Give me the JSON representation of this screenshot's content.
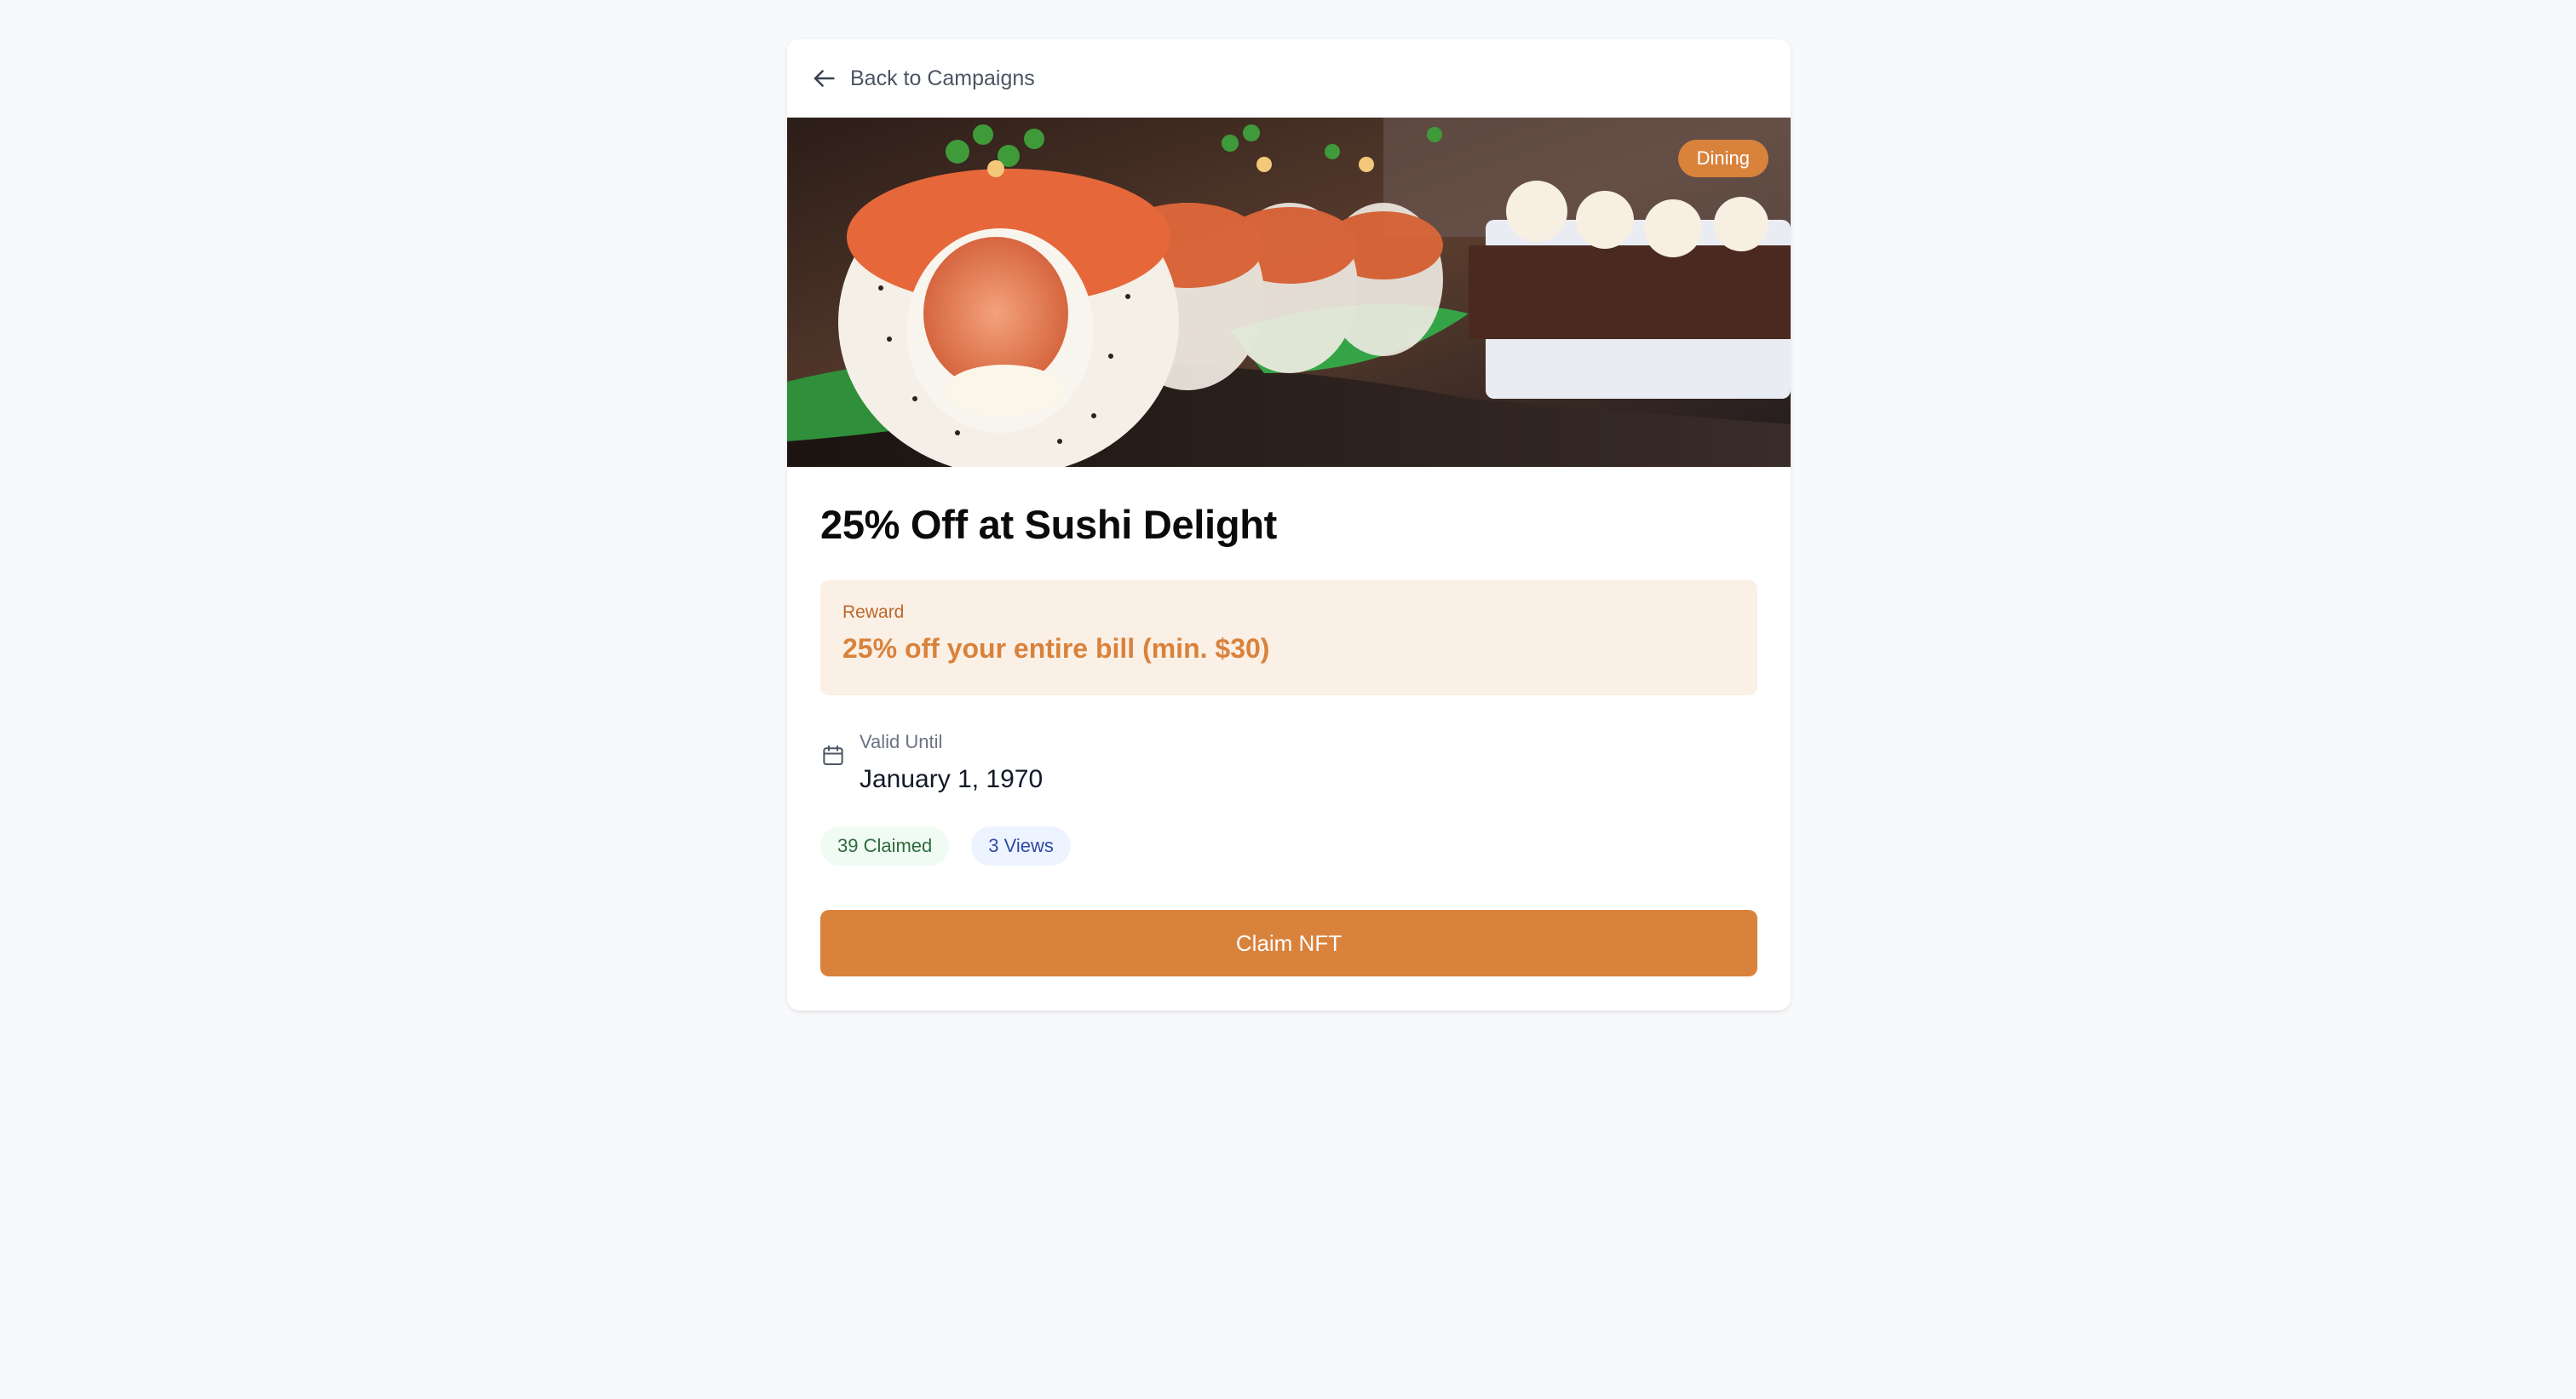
{
  "nav": {
    "back_label": "Back to Campaigns",
    "back_icon": "arrow-left-icon"
  },
  "campaign": {
    "category_badge": "Dining",
    "title": "25% Off at Sushi Delight",
    "hero_image": "sushi-rolls-photo"
  },
  "reward": {
    "label": "Reward",
    "value": "25% off your entire bill (min. $30)"
  },
  "validity": {
    "icon": "calendar-icon",
    "label": "Valid Until",
    "date": "January 1, 1970"
  },
  "stats": {
    "claimed": "39 Claimed",
    "views": "3 Views"
  },
  "actions": {
    "claim_label": "Claim NFT"
  },
  "colors": {
    "accent": "#d9823c",
    "reward_bg": "#fbf0e6",
    "claimed_bg": "#f0fbf3",
    "views_bg": "#eef4ff",
    "page_bg": "#f8f9fb"
  }
}
